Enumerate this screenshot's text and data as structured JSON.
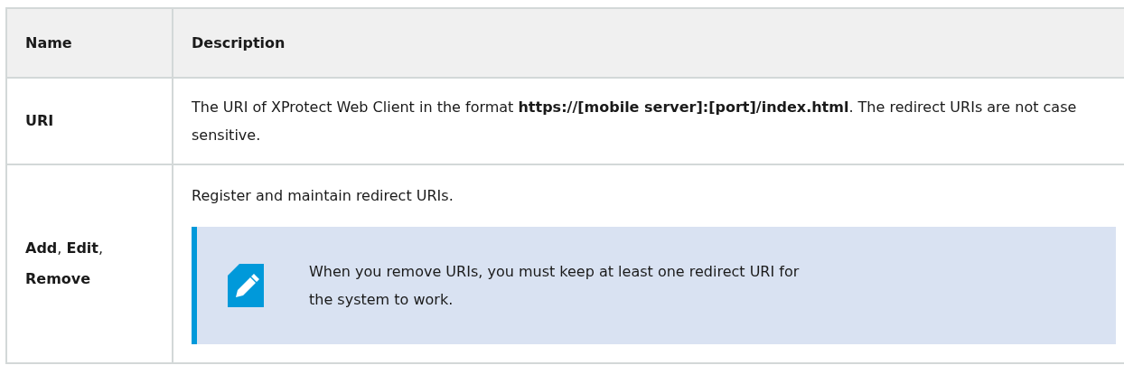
{
  "table": {
    "columns": [
      "Name",
      "Description"
    ],
    "rows": [
      {
        "name": "URI",
        "description": [
          "The URI of XProtect Web Client in the format **https://[mobile server]:[port]/index.html**. The redirect URIs are not case sensitive."
        ]
      },
      {
        "name": "**Add**, **Edit**, **Remove**",
        "description": [
          "Register and maintain redirect URIs."
        ],
        "note": {
          "kind": "note",
          "text": "When you remove URIs, you must keep at least one redirect URI for the system to work."
        }
      }
    ]
  }
}
